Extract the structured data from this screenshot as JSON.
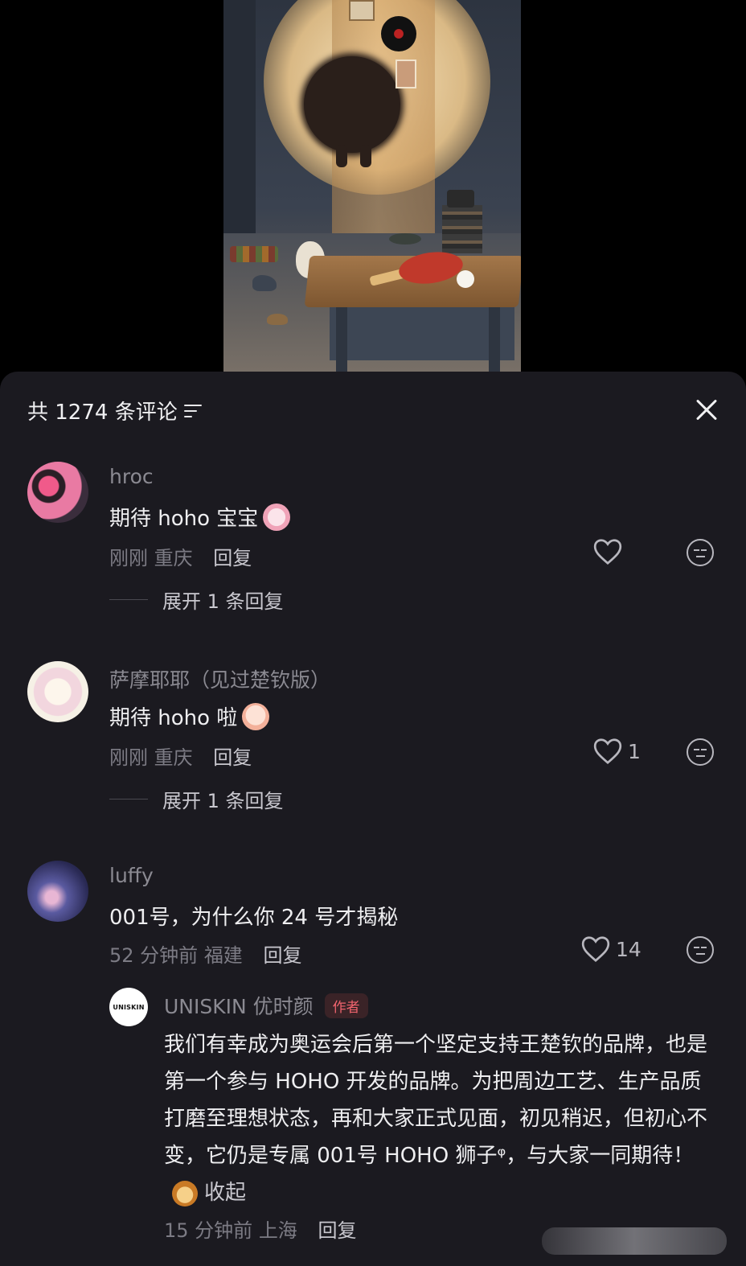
{
  "header": {
    "comment_count_label": "共 1274 条评论"
  },
  "comments": [
    {
      "username": "hroc",
      "text": "期待 hoho 宝宝",
      "time": "刚刚",
      "location": "重庆",
      "reply_label": "回复",
      "likes": "",
      "expand_label": "展开 1 条回复"
    },
    {
      "username": "萨摩耶耶（见过楚钦版）",
      "text": "期待 hoho 啦",
      "time": "刚刚",
      "location": "重庆",
      "reply_label": "回复",
      "likes": "1",
      "expand_label": "展开 1 条回复"
    },
    {
      "username": "luffy",
      "text": "001号，为什么你 24 号才揭秘",
      "time": "52 分钟前",
      "location": "福建",
      "reply_label": "回复",
      "likes": "14"
    }
  ],
  "author_reply": {
    "avatar_text": "UNISKIN",
    "username": "UNISKIN 优时颜",
    "badge": "作者",
    "text": "我们有幸成为奥运会后第一个坚定支持王楚钦的品牌，也是第一个参与 HOHO 开发的品牌。为把周边工艺、生产品质打磨至理想状态，再和大家正式见面，初见稍迟，但初心不变，它仍是专属 001号 HOHO 狮子ᵠ，与大家一同期待！",
    "collapse_label": "收起",
    "time": "15 分钟前",
    "location": "上海",
    "reply_label": "回复"
  },
  "colors": {
    "panel_bg": "#1b1a20",
    "author_badge": "#f0646e"
  },
  "icons": [
    "filter-icon",
    "close-icon",
    "heart-icon",
    "dislike-face-icon",
    "lion-emoji-icon"
  ]
}
